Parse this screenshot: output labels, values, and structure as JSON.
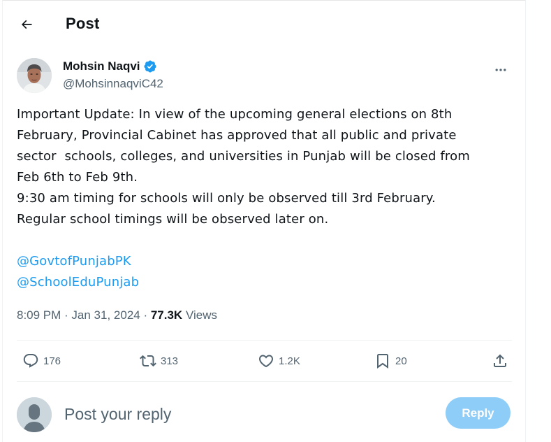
{
  "header": {
    "back_icon": "arrow-left-icon",
    "title": "Post"
  },
  "author": {
    "display_name": "Mohsin Naqvi",
    "handle": "@MohsinnaqviC42",
    "verified": true,
    "verified_color": "#1d9bf0",
    "more_icon": "more-horizontal-icon"
  },
  "tweet": {
    "lines": [
      "Important Update: In view of the upcoming general elections on 8th",
      "February, Provincial Cabinet has approved that all public and private",
      "sector  schools, colleges, and universities in Punjab will be closed from",
      "Feb 6th to Feb 9th.",
      "9:30 am timing for schools will only be observed till 3rd February.",
      "Regular school timings will be observed later on."
    ],
    "mentions": [
      "@GovtofPunjabPK",
      "@SchoolEduPunjab"
    ],
    "link_color": "#1d9bf0"
  },
  "meta": {
    "time": "8:09 PM",
    "separator": " · ",
    "date": "Jan 31, 2024",
    "views_count": "77.3K",
    "views_label": " Views"
  },
  "actions": {
    "reply": {
      "icon": "comment-icon",
      "count": "176"
    },
    "repost": {
      "icon": "repost-icon",
      "count": "313"
    },
    "like": {
      "icon": "heart-icon",
      "count": "1.2K"
    },
    "bookmark": {
      "icon": "bookmark-icon",
      "count": "20"
    },
    "share": {
      "icon": "share-icon"
    }
  },
  "reply_box": {
    "placeholder": "Post your reply",
    "value": "",
    "button_label": "Reply",
    "button_color": "#8ecdf8"
  }
}
